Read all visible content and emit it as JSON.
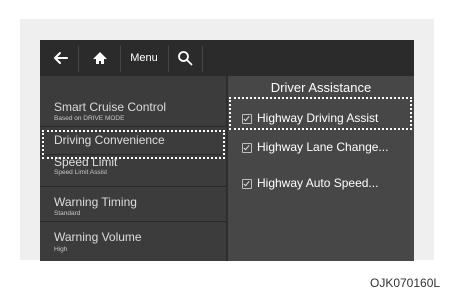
{
  "toolbar": {
    "back_icon": "back-arrow-icon",
    "home_icon": "home-icon",
    "menu_label": "Menu",
    "search_icon": "search-icon"
  },
  "left_menu": [
    {
      "title": "Smart Cruise Control",
      "subtitle": "Based on DRIVE MODE"
    },
    {
      "title": "Driving Convenience",
      "subtitle": ""
    },
    {
      "title": "Speed Limit",
      "subtitle": "Speed Limit Assist"
    },
    {
      "title": "Warning Timing",
      "subtitle": "Standard"
    },
    {
      "title": "Warning Volume",
      "subtitle": "High"
    }
  ],
  "right_panel": {
    "title": "Driver Assistance",
    "options": [
      {
        "label": "Highway Driving Assist",
        "checked": true
      },
      {
        "label": "Highway Lane Change...",
        "checked": true
      },
      {
        "label": "Highway Auto Speed...",
        "checked": true
      }
    ]
  },
  "caption": "OJK070160L"
}
